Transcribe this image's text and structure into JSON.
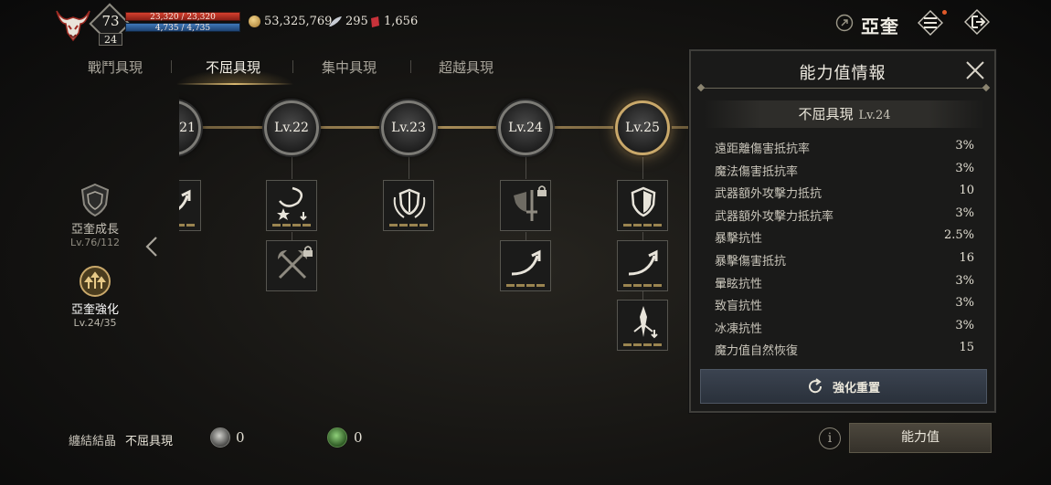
{
  "player": {
    "level": "73",
    "sub_level": "24",
    "hp": "23,320 / 23,320",
    "mp": "4,735 / 4,735"
  },
  "currencies": [
    {
      "icon": "gold-coin-icon",
      "value": "53,325,769"
    },
    {
      "icon": "feather-icon",
      "value": "295"
    },
    {
      "icon": "red-gem-icon",
      "value": "1,656"
    }
  ],
  "header": {
    "clan_name": "亞奎"
  },
  "tabs": [
    {
      "label": "戰鬥具現",
      "active": false
    },
    {
      "label": "不屈具現",
      "active": true
    },
    {
      "label": "集中具現",
      "active": false
    },
    {
      "label": "超越具現",
      "active": false
    }
  ],
  "nav": [
    {
      "label": "亞奎成長",
      "sub": "Lv.76/112",
      "icon": "shield-emblem-icon",
      "active": false
    },
    {
      "label": "亞奎強化",
      "sub": "Lv.24/35",
      "icon": "upgrade-emblem-icon",
      "active": true
    }
  ],
  "tree": {
    "nodes": [
      "21",
      "Lv.22",
      "Lv.23",
      "Lv.24",
      "Lv.25"
    ],
    "skills": [
      {
        "node": 0,
        "icon": "arrow-swirl-icon",
        "locked": false
      },
      {
        "node": 1,
        "icon": "star-swirl-icon",
        "locked": false
      },
      {
        "node": 1,
        "icon": "crossed-axes-icon",
        "locked": true
      },
      {
        "node": 2,
        "icon": "laurel-shield-icon",
        "locked": false
      },
      {
        "node": 3,
        "icon": "sword-shield-icon",
        "locked": true
      },
      {
        "node": 3,
        "icon": "arrow-swirl-icon",
        "locked": false
      },
      {
        "node": 4,
        "icon": "shield-icon",
        "locked": false
      },
      {
        "node": 4,
        "icon": "arrow-swirl-icon",
        "locked": false
      },
      {
        "node": 4,
        "icon": "spear-icon",
        "locked": false
      }
    ]
  },
  "panel": {
    "title": "能力值情報",
    "subtitle": "不屈具現",
    "subtitle_level": "Lv.24",
    "stats": [
      {
        "name": "遠距離傷害抵抗率",
        "value": "3%"
      },
      {
        "name": "魔法傷害抵抗率",
        "value": "3%"
      },
      {
        "name": "武器額外攻擊力抵抗",
        "value": "10"
      },
      {
        "name": "武器額外攻擊力抵抗率",
        "value": "3%"
      },
      {
        "name": "暴擊抗性",
        "value": "2.5%"
      },
      {
        "name": "暴擊傷害抵抗",
        "value": "16"
      },
      {
        "name": "暈眩抗性",
        "value": "3%"
      },
      {
        "name": "致盲抗性",
        "value": "3%"
      },
      {
        "name": "冰凍抗性",
        "value": "3%"
      },
      {
        "name": "魔力值自然恢復",
        "value": "15"
      }
    ],
    "reset_button": "強化重置"
  },
  "bottom": {
    "crystal_label": "纏結結晶",
    "crystal_type": "不屈具現",
    "crystal_a_count": "0",
    "crystal_b_count": "0",
    "stats_button": "能力值"
  },
  "colors": {
    "gold": "#c9a86a",
    "hp": "#d5412f",
    "mp": "#3f77b8"
  }
}
